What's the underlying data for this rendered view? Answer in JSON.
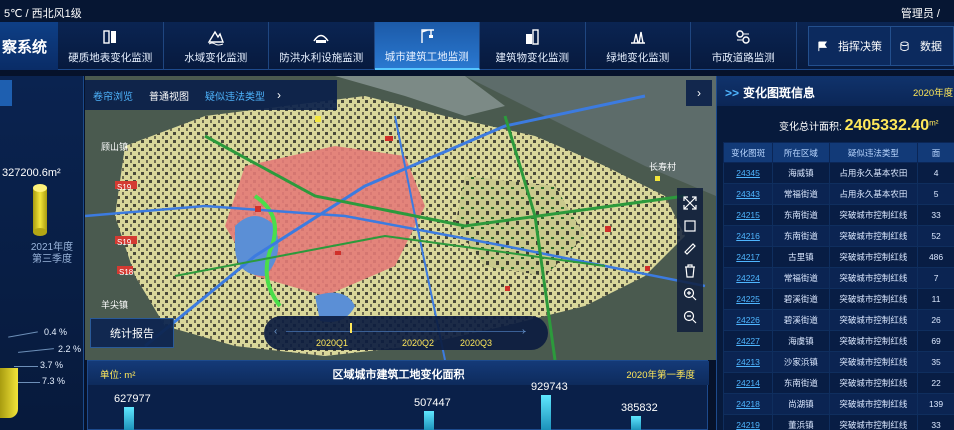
{
  "topbar": {
    "weather": "5℃ / 西北风1级",
    "user": "管理员 /"
  },
  "system_title": "察系统",
  "nav": {
    "tabs": [
      {
        "label": "硬质地表变化监测",
        "icon": "hard-surface-icon"
      },
      {
        "label": "水域变化监测",
        "icon": "water-icon"
      },
      {
        "label": "防洪水利设施监测",
        "icon": "flood-control-icon"
      },
      {
        "label": "城市建筑工地监测",
        "icon": "construction-crane-icon",
        "active": true
      },
      {
        "label": "建筑物变化监测",
        "icon": "building-icon"
      },
      {
        "label": "绿地变化监测",
        "icon": "greenland-icon"
      },
      {
        "label": "市政道路监测",
        "icon": "road-icon"
      }
    ],
    "right": [
      {
        "label": "指挥决策",
        "icon": "flag-icon"
      },
      {
        "label": "数据",
        "icon": "database-icon"
      }
    ]
  },
  "left_panel": {
    "area_text": "327200.6m²",
    "year_text": "2021年度",
    "quarter_text": "第三季度",
    "percentages": [
      "0.4 %",
      "2.2 %",
      "3.7 %",
      "7.3 %"
    ]
  },
  "map": {
    "view_tabs": [
      {
        "label": "卷帘浏览",
        "selected": false
      },
      {
        "label": "普通视图",
        "selected": true
      },
      {
        "label": "疑似违法类型",
        "selected": false
      }
    ],
    "place_labels": [
      "顾山镇",
      "长寿村",
      "羊尖镇",
      "S19",
      "S19",
      "S18"
    ],
    "report_button": "统计报告",
    "timeline": {
      "labels": [
        "2020Q1",
        "2020Q2",
        "2020Q3"
      ],
      "current": "2020Q1"
    },
    "tools": [
      "expand-icon",
      "select-box-icon",
      "ruler-icon",
      "trash-icon",
      "zoom-in-icon",
      "zoom-out-icon"
    ]
  },
  "bottom_chart": {
    "unit_label": "单位: m²",
    "year_label": "2020年第一季度",
    "chart_data": {
      "type": "bar",
      "title": "区域城市建筑工地变化面积",
      "values": [
        627977,
        507447,
        929743,
        385832
      ],
      "ylabel": "m²"
    }
  },
  "right_panel": {
    "title_prefix": ">>",
    "title": "变化图斑信息",
    "year": "2020年度",
    "total_label": "变化总计面积:",
    "total_value": "2405332.40",
    "total_unit": "m²",
    "columns": [
      "变化图斑",
      "所在区域",
      "疑似违法类型",
      "面"
    ],
    "rows": [
      [
        "24345",
        "海威镇",
        "占用永久基本农田",
        "4"
      ],
      [
        "24343",
        "常福街道",
        "占用永久基本农田",
        "5"
      ],
      [
        "24215",
        "东南街道",
        "突破城市控制红线",
        "33"
      ],
      [
        "24216",
        "东南街道",
        "突破城市控制红线",
        "52"
      ],
      [
        "24217",
        "古里镇",
        "突破城市控制红线",
        "486"
      ],
      [
        "24224",
        "常福街道",
        "突破城市控制红线",
        "7"
      ],
      [
        "24225",
        "碧溪街道",
        "突破城市控制红线",
        "11"
      ],
      [
        "24226",
        "碧溪街道",
        "突破城市控制红线",
        "26"
      ],
      [
        "24227",
        "海虞镇",
        "突破城市控制红线",
        "69"
      ],
      [
        "24213",
        "沙家浜镇",
        "突破城市控制红线",
        "35"
      ],
      [
        "24214",
        "东南街道",
        "突破城市控制红线",
        "22"
      ],
      [
        "24218",
        "尚湖镇",
        "突破城市控制红线",
        "139"
      ],
      [
        "24219",
        "董浜镇",
        "突破城市控制红线",
        "33"
      ]
    ]
  }
}
